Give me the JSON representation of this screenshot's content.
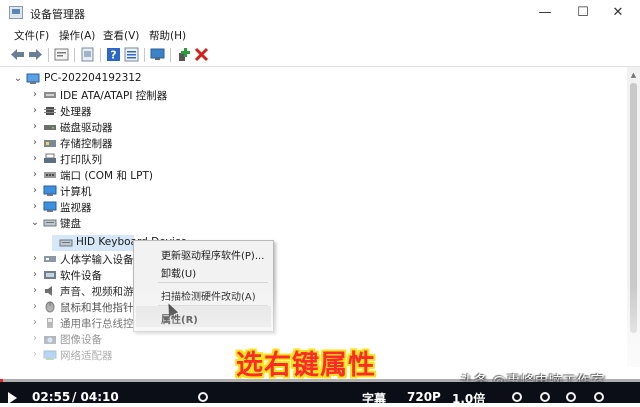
{
  "window": {
    "title": "设备管理器",
    "controls": {
      "minimize": "—",
      "maximize": "☐",
      "close": "✕"
    }
  },
  "menu": [
    "文件(F)",
    "操作(A)",
    "查看(V)",
    "帮助(H)"
  ],
  "toolbar": {
    "icons": [
      "back-arrow-icon",
      "forward-arrow-icon",
      "properties-icon",
      "driver-icon",
      "help-icon",
      "details-icon",
      "monitor-icon",
      "add-driver-icon",
      "uninstall-icon"
    ],
    "colors": {
      "help": "#2c67c7",
      "add": "#2a9a3a",
      "remove": "#d3211a"
    }
  },
  "tree": {
    "root": "PC-202204192312",
    "items": [
      {
        "label": "IDE ATA/ATAPI 控制器",
        "icon": "ide-controller-icon",
        "expanded": false
      },
      {
        "label": "处理器",
        "icon": "processor-icon",
        "expanded": false
      },
      {
        "label": "磁盘驱动器",
        "icon": "disk-drive-icon",
        "expanded": false
      },
      {
        "label": "存储控制器",
        "icon": "storage-controller-icon",
        "expanded": false
      },
      {
        "label": "打印队列",
        "icon": "printer-icon",
        "expanded": false
      },
      {
        "label": "端口 (COM 和 LPT)",
        "icon": "port-icon",
        "expanded": false
      },
      {
        "label": "计算机",
        "icon": "computer-icon",
        "expanded": false
      },
      {
        "label": "监视器",
        "icon": "monitor-icon",
        "expanded": false
      },
      {
        "label": "键盘",
        "icon": "keyboard-icon",
        "expanded": true
      },
      {
        "label": "HID Keyboard Device",
        "icon": "keyboard-device-icon",
        "child": true,
        "selected": true
      },
      {
        "label": "人体学输入设备",
        "icon": "hid-icon",
        "expanded": false
      },
      {
        "label": "软件设备",
        "icon": "software-device-icon",
        "expanded": false
      },
      {
        "label": "声音、视频和游戏",
        "icon": "sound-icon",
        "expanded": false
      },
      {
        "label": "鼠标和其他指针",
        "icon": "mouse-icon",
        "expanded": false
      },
      {
        "label": "通用串行总线控",
        "icon": "usb-icon",
        "expanded": false
      },
      {
        "label": "图像设备",
        "icon": "camera-icon",
        "expanded": false
      },
      {
        "label": "网络适配器",
        "icon": "network-adapter-icon",
        "expanded": false
      }
    ]
  },
  "context_menu": {
    "items": [
      {
        "label": "更新驱动程序软件(P)...",
        "separator_after": false
      },
      {
        "label": "卸载(U)",
        "separator_after": true
      },
      {
        "label": "扫描检测硬件改动(A)",
        "separator_after": true
      },
      {
        "label": "属性(R)",
        "bold": true,
        "hover": true
      }
    ]
  },
  "caption": "选右键属性",
  "player": {
    "current_time": "02:55",
    "duration": "/ 04:10",
    "progress": 0.005,
    "subtitle_btn": "字幕",
    "quality": "720P",
    "speed": "1.0倍"
  },
  "watermark": "头条 @惠峰电脑工作室"
}
